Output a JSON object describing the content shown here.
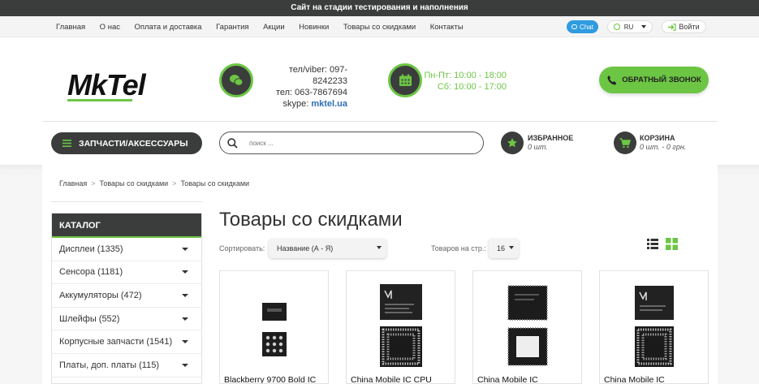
{
  "banner": "Сайт на стадии тестирования и наполнения",
  "nav": {
    "links": [
      "Главная",
      "О нас",
      "Оплата и доставка",
      "Гарантия",
      "Акции",
      "Новинки",
      "Товары со скидками",
      "Контакты"
    ],
    "chat_label": "Chat",
    "lang": "RU",
    "login": "Войти"
  },
  "logo": {
    "text": "MkTel",
    "accent": "#6cc644"
  },
  "contacts": {
    "phone1": "тел/viber: 097-8242233",
    "phone2": "тел: 063-7867694",
    "skype_label": "skype: ",
    "skype_value": "mktel.ua"
  },
  "hours": {
    "weekdays": "Пн-Пт: 10:00 - 18:00",
    "saturday": "Сб: 10:00 - 17:00"
  },
  "callback_label": "ОБРАТНЫЙ ЗВОНОК",
  "catalog_button": "ЗАПЧАСТИ/АКСЕССУАРЫ",
  "search": {
    "placeholder": "поиск ..."
  },
  "favorites": {
    "title": "ИЗБРАННОЕ",
    "count": "0 шт."
  },
  "cart": {
    "title": "КОРЗИНА",
    "summary": "0 шт. - 0 грн."
  },
  "breadcrumb": [
    "Главная",
    "Товары со скидками",
    "Товары со скидками"
  ],
  "sidebar": {
    "title": "КАТАЛОГ",
    "items": [
      "Дисплеи (1335)",
      "Сенсора (1181)",
      "Аккумуляторы (472)",
      "Шлейфы (552)",
      "Корпусные запчасти (1541)",
      "Платы, доп. платы (115)"
    ]
  },
  "page_title": "Товары со скидками",
  "sort": {
    "label": "Сортировать:",
    "value": "Название (А - Я)"
  },
  "per_page": {
    "label": "Товаров на стр.:",
    "value": "16"
  },
  "products": [
    {
      "name": "Blackberry 9700 Bold IC"
    },
    {
      "name": "China Mobile IC CPU"
    },
    {
      "name": "China Mobile IC"
    },
    {
      "name": "China Mobile IC"
    }
  ],
  "colors": {
    "dark": "#3b3d3c",
    "green": "#6cc644",
    "link_blue": "#2f6fb6",
    "chat_blue": "#2f9be0"
  }
}
